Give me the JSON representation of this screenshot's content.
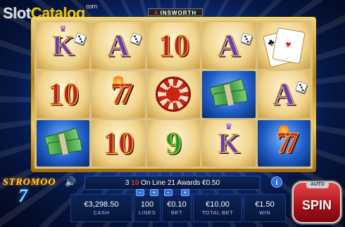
{
  "watermark": {
    "part1": "Slot",
    "part2": "Catalog",
    "suffix": "com"
  },
  "brand": {
    "name": "INSWORTH",
    "mark": "A"
  },
  "reels": [
    [
      {
        "sym": "K",
        "style": "gold",
        "extra": "crown-dice"
      },
      {
        "sym": "10",
        "style": "gold"
      },
      {
        "sym": "money",
        "style": "blue"
      }
    ],
    [
      {
        "sym": "A",
        "style": "gold",
        "extra": "dice"
      },
      {
        "sym": "77",
        "style": "gold"
      },
      {
        "sym": "10",
        "style": "gold"
      }
    ],
    [
      {
        "sym": "10",
        "style": "gold"
      },
      {
        "sym": "chip",
        "style": "gold"
      },
      {
        "sym": "9",
        "style": "gold"
      }
    ],
    [
      {
        "sym": "A",
        "style": "gold",
        "extra": "dice"
      },
      {
        "sym": "money",
        "style": "blue"
      },
      {
        "sym": "K",
        "style": "gold",
        "extra": "crown"
      }
    ],
    [
      {
        "sym": "cards",
        "style": "gold"
      },
      {
        "sym": "A",
        "style": "gold",
        "extra": "dice"
      },
      {
        "sym": "77",
        "style": "blue"
      }
    ]
  ],
  "message": {
    "prefix": "3",
    "symbol": "10",
    "text": "On Line 21 Awards €0.50"
  },
  "game_logo": {
    "line1": "STROMOO",
    "line2": "7"
  },
  "stats": [
    {
      "value": "€3,298.50",
      "label": "CASH",
      "controls": false
    },
    {
      "value": "100",
      "label": "LINES",
      "controls": true
    },
    {
      "value": "€0.10",
      "label": "BET",
      "controls": true
    },
    {
      "value": "€10.00",
      "label": "TOTAL BET",
      "controls": false
    },
    {
      "value": "€1.50",
      "label": "WIN",
      "controls": false
    }
  ],
  "controls": {
    "minus": "−",
    "plus": "+",
    "spin": "SPIN",
    "auto": "AUTO",
    "info": "i",
    "sound_icon": "speaker-icon"
  }
}
